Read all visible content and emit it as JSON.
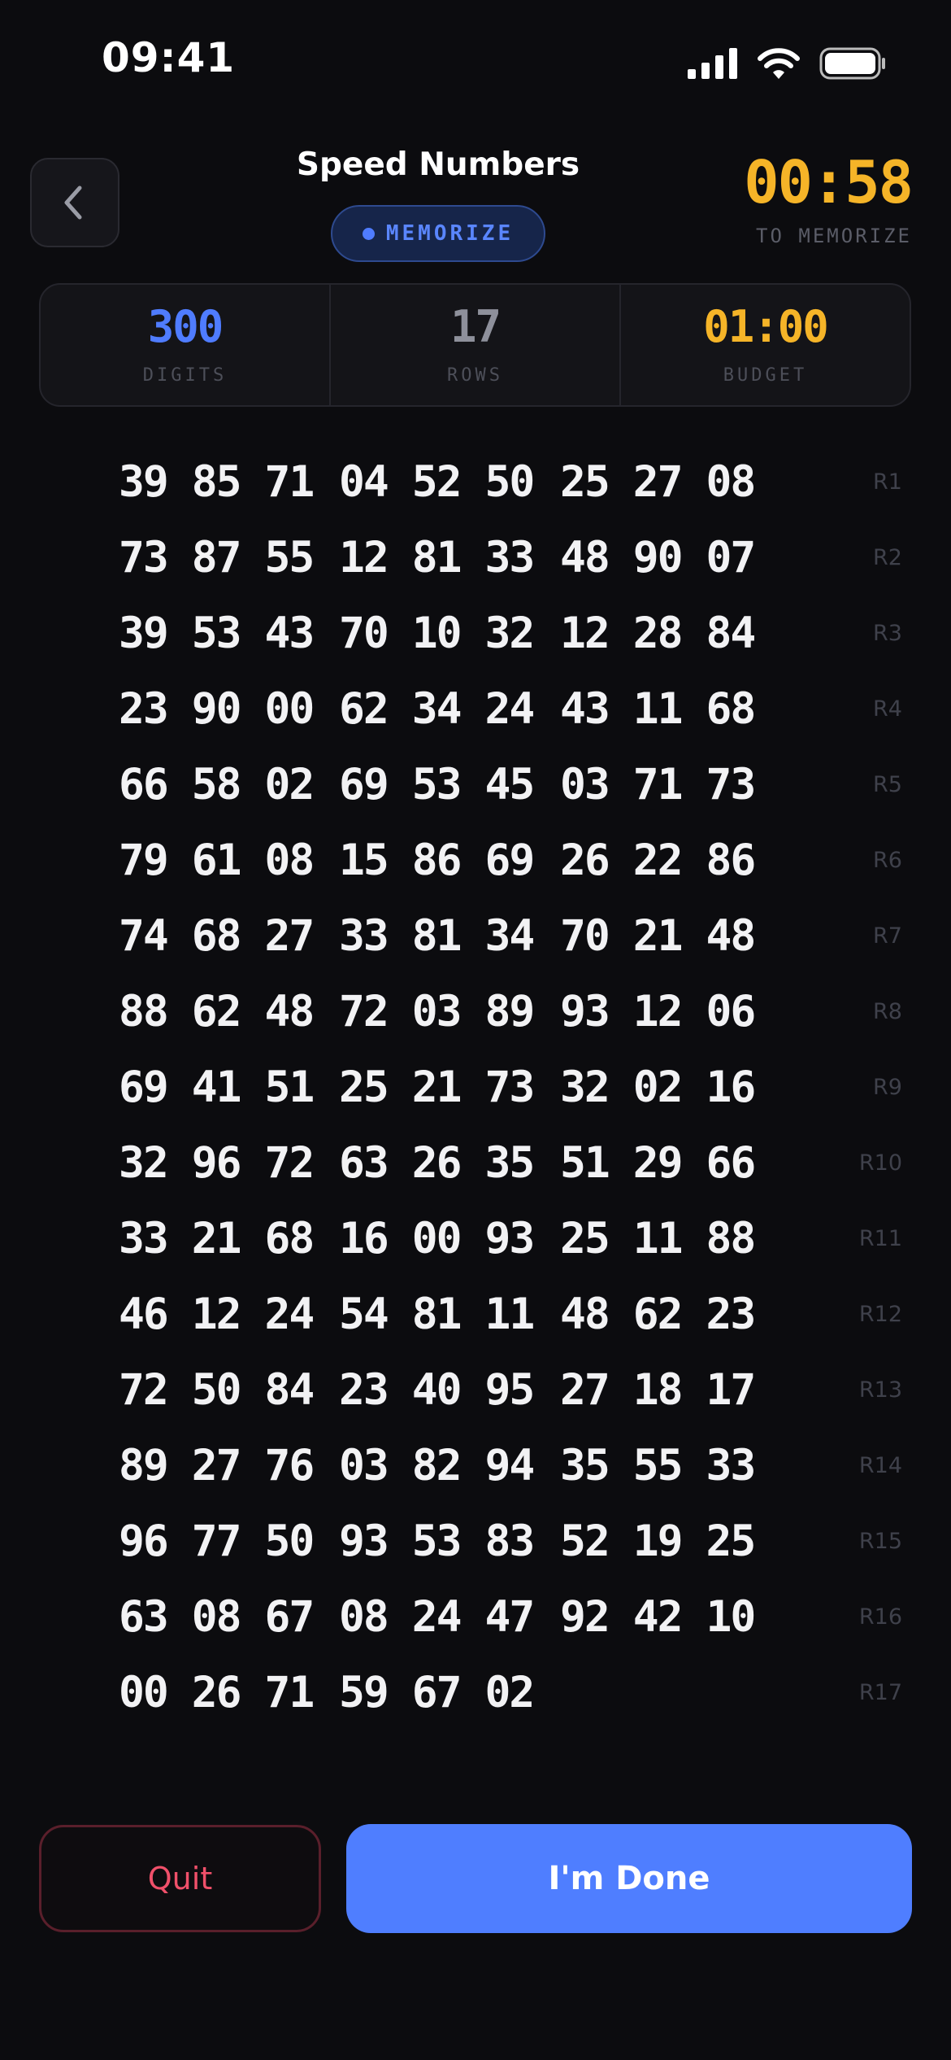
{
  "status_bar": {
    "time": "09:41"
  },
  "header": {
    "title": "Speed Numbers",
    "mode_label": "MEMORIZE",
    "timer": "00:58",
    "timer_caption": "TO MEMORIZE"
  },
  "stats": [
    {
      "value": "300",
      "label": "DIGITS",
      "color": "#4f7cff"
    },
    {
      "value": "17",
      "label": "ROWS",
      "color": "#8e909b"
    },
    {
      "value": "01:00",
      "label": "BUDGET",
      "color": "#f5b428"
    }
  ],
  "rows": [
    {
      "label": "R1",
      "groups": [
        "39 85 71",
        "04 52 50",
        "25 27 08"
      ]
    },
    {
      "label": "R2",
      "groups": [
        "73 87 55",
        "12 81 33",
        "48 90 07"
      ]
    },
    {
      "label": "R3",
      "groups": [
        "39 53 43",
        "70 10 32",
        "12 28 84"
      ]
    },
    {
      "label": "R4",
      "groups": [
        "23 90 00",
        "62 34 24",
        "43 11 68"
      ]
    },
    {
      "label": "R5",
      "groups": [
        "66 58 02",
        "69 53 45",
        "03 71 73"
      ]
    },
    {
      "label": "R6",
      "groups": [
        "79 61 08",
        "15 86 69",
        "26 22 86"
      ]
    },
    {
      "label": "R7",
      "groups": [
        "74 68 27",
        "33 81 34",
        "70 21 48"
      ]
    },
    {
      "label": "R8",
      "groups": [
        "88 62 48",
        "72 03 89",
        "93 12 06"
      ]
    },
    {
      "label": "R9",
      "groups": [
        "69 41 51",
        "25 21 73",
        "32 02 16"
      ]
    },
    {
      "label": "R10",
      "groups": [
        "32 96 72",
        "63 26 35",
        "51 29 66"
      ]
    },
    {
      "label": "R11",
      "groups": [
        "33 21 68",
        "16 00 93",
        "25 11 88"
      ]
    },
    {
      "label": "R12",
      "groups": [
        "46 12 24",
        "54 81 11",
        "48 62 23"
      ]
    },
    {
      "label": "R13",
      "groups": [
        "72 50 84",
        "23 40 95",
        "27 18 17"
      ]
    },
    {
      "label": "R14",
      "groups": [
        "89 27 76",
        "03 82 94",
        "35 55 33"
      ]
    },
    {
      "label": "R15",
      "groups": [
        "96 77 50",
        "93 53 83",
        "52 19 25"
      ]
    },
    {
      "label": "R16",
      "groups": [
        "63 08 67",
        "08 24 47",
        "92 42 10"
      ]
    },
    {
      "label": "R17",
      "groups": [
        "00 26 71",
        "59 67 02",
        ""
      ]
    }
  ],
  "actions": {
    "quit_label": "Quit",
    "done_label": "I'm Done"
  }
}
